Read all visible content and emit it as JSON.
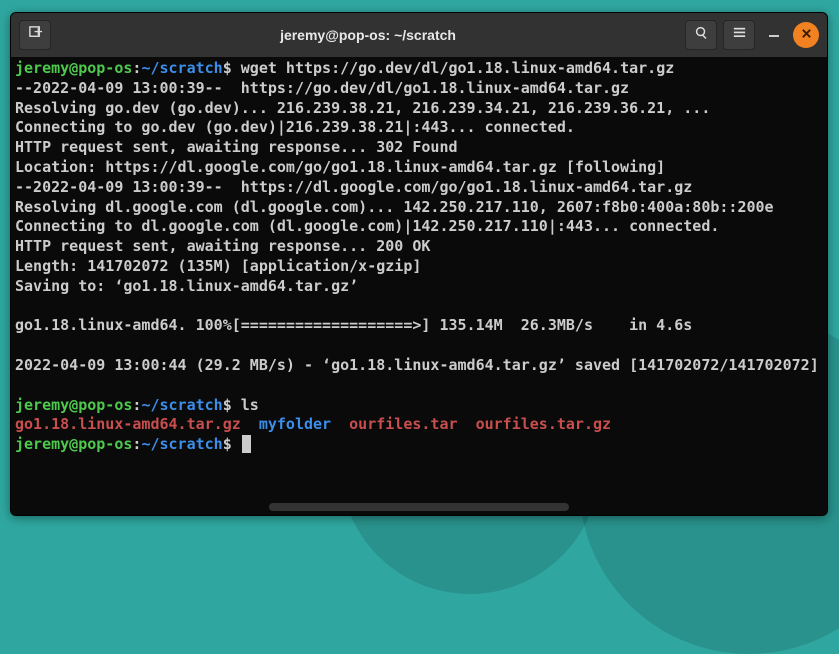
{
  "window": {
    "title": "jeremy@pop-os: ~/scratch"
  },
  "prompts": [
    {
      "user": "jeremy@pop-os",
      "path": "~/scratch",
      "command": "wget https://go.dev/dl/go1.18.linux-amd64.tar.gz"
    },
    {
      "user": "jeremy@pop-os",
      "path": "~/scratch",
      "command": "ls"
    },
    {
      "user": "jeremy@pop-os",
      "path": "~/scratch",
      "command": ""
    }
  ],
  "wget_output": [
    "--2022-04-09 13:00:39--  https://go.dev/dl/go1.18.linux-amd64.tar.gz",
    "Resolving go.dev (go.dev)... 216.239.38.21, 216.239.34.21, 216.239.36.21, ...",
    "Connecting to go.dev (go.dev)|216.239.38.21|:443... connected.",
    "HTTP request sent, awaiting response... 302 Found",
    "Location: https://dl.google.com/go/go1.18.linux-amd64.tar.gz [following]",
    "--2022-04-09 13:00:39--  https://dl.google.com/go/go1.18.linux-amd64.tar.gz",
    "Resolving dl.google.com (dl.google.com)... 142.250.217.110, 2607:f8b0:400a:80b::200e",
    "Connecting to dl.google.com (dl.google.com)|142.250.217.110|:443... connected.",
    "HTTP request sent, awaiting response... 200 OK",
    "Length: 141702072 (135M) [application/x-gzip]",
    "Saving to: ‘go1.18.linux-amd64.tar.gz’",
    "",
    "go1.18.linux-amd64. 100%[===================>] 135.14M  26.3MB/s    in 4.6s",
    "",
    "2022-04-09 13:00:44 (29.2 MB/s) - ‘go1.18.linux-amd64.tar.gz’ saved [141702072/141702072]",
    ""
  ],
  "ls_output": {
    "items": [
      {
        "name": "go1.18.linux-amd64.tar.gz",
        "type": "archive"
      },
      {
        "name": "myfolder",
        "type": "dir"
      },
      {
        "name": "ourfiles.tar",
        "type": "archive"
      },
      {
        "name": "ourfiles.tar.gz",
        "type": "archive"
      }
    ]
  }
}
